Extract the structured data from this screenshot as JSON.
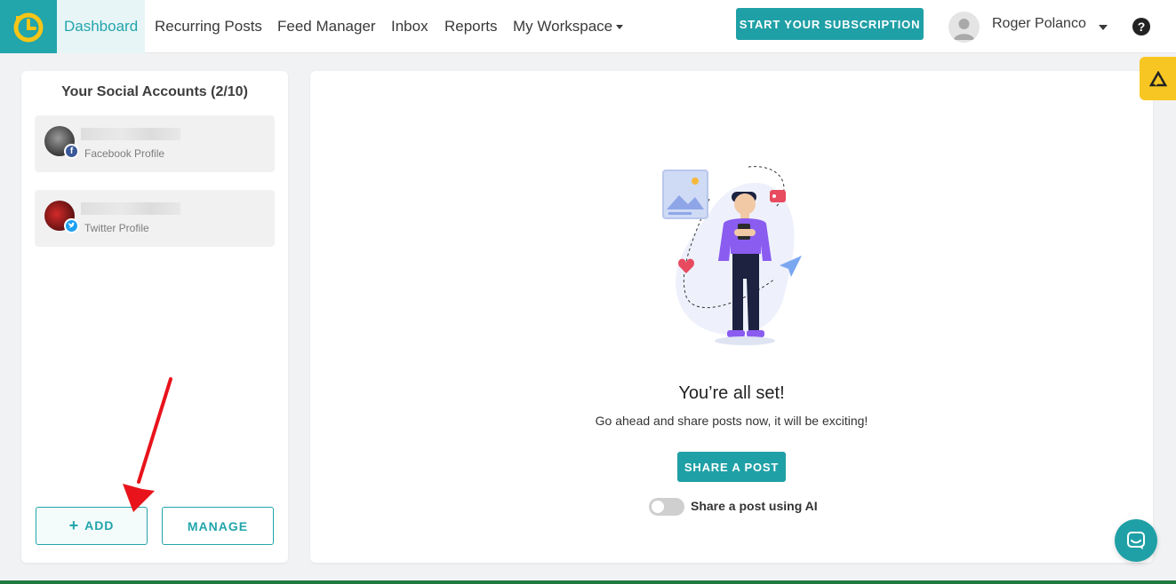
{
  "nav": {
    "items": [
      {
        "label": "Dashboard",
        "active": true
      },
      {
        "label": "Recurring Posts"
      },
      {
        "label": "Feed Manager"
      },
      {
        "label": "Inbox"
      },
      {
        "label": "Reports"
      },
      {
        "label": "My Workspace"
      }
    ],
    "subscribe_label": "START YOUR SUBSCRIPTION",
    "user_name": "Roger Polanco",
    "help_glyph": "?"
  },
  "sidebar": {
    "title": "Your Social Accounts (2/10)",
    "accounts": [
      {
        "type": "Facebook Profile",
        "network_icon": "facebook-icon"
      },
      {
        "type": "Twitter Profile",
        "network_icon": "twitter-icon"
      }
    ],
    "add_label": "ADD",
    "manage_label": "MANAGE"
  },
  "main": {
    "heading": "You’re all set!",
    "subtitle": "Go ahead and share posts now, it will be exciting!",
    "share_label": "SHARE A POST",
    "ai_toggle_label": "Share a post using AI",
    "ai_toggle_on": false
  },
  "colors": {
    "accent": "#1fa0a6",
    "side_widget": "#f7c623",
    "annotation_arrow": "#e8131b"
  }
}
